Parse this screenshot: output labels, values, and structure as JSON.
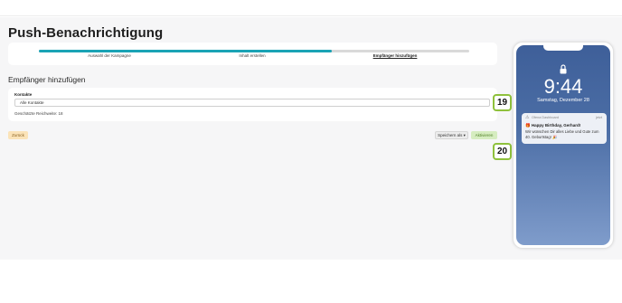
{
  "page": {
    "title": "Push-Benachrichtigung",
    "section_title": "Empfänger hinzufügen"
  },
  "stepper": {
    "progress": 0.68,
    "steps": [
      {
        "label": "Auswahl der Kampagne"
      },
      {
        "label": "Inhalt erstellen"
      },
      {
        "label": "Empfänger hinzufügen"
      }
    ]
  },
  "recipients": {
    "field_label": "Kontakte",
    "selected_value": "Alle Kontakte",
    "reach_text": "Geschätzte Reichweite: 18"
  },
  "badges": {
    "b19": "19",
    "b20": "20"
  },
  "buttons": {
    "back": "Zurück",
    "save_as": "Speichern als ▾",
    "activate": "Aktivieren"
  },
  "phone": {
    "time": "9:44",
    "date": "Samstag, Dezember 28",
    "notification": {
      "app_icon": "⚠",
      "app_name": "Ofena Dashboard",
      "time": "jetzt",
      "title": "🎁 Happy Birthday, Gerhard!",
      "body": "Wir wünschen Dir alles Liebe und Gute zum 40. Geburtstag! 🎉"
    }
  },
  "colors": {
    "accent": "#1aa3b5",
    "badge_border": "#8fc13c",
    "back_bg": "#fbe3b8",
    "activate_bg": "#d6edc0"
  }
}
